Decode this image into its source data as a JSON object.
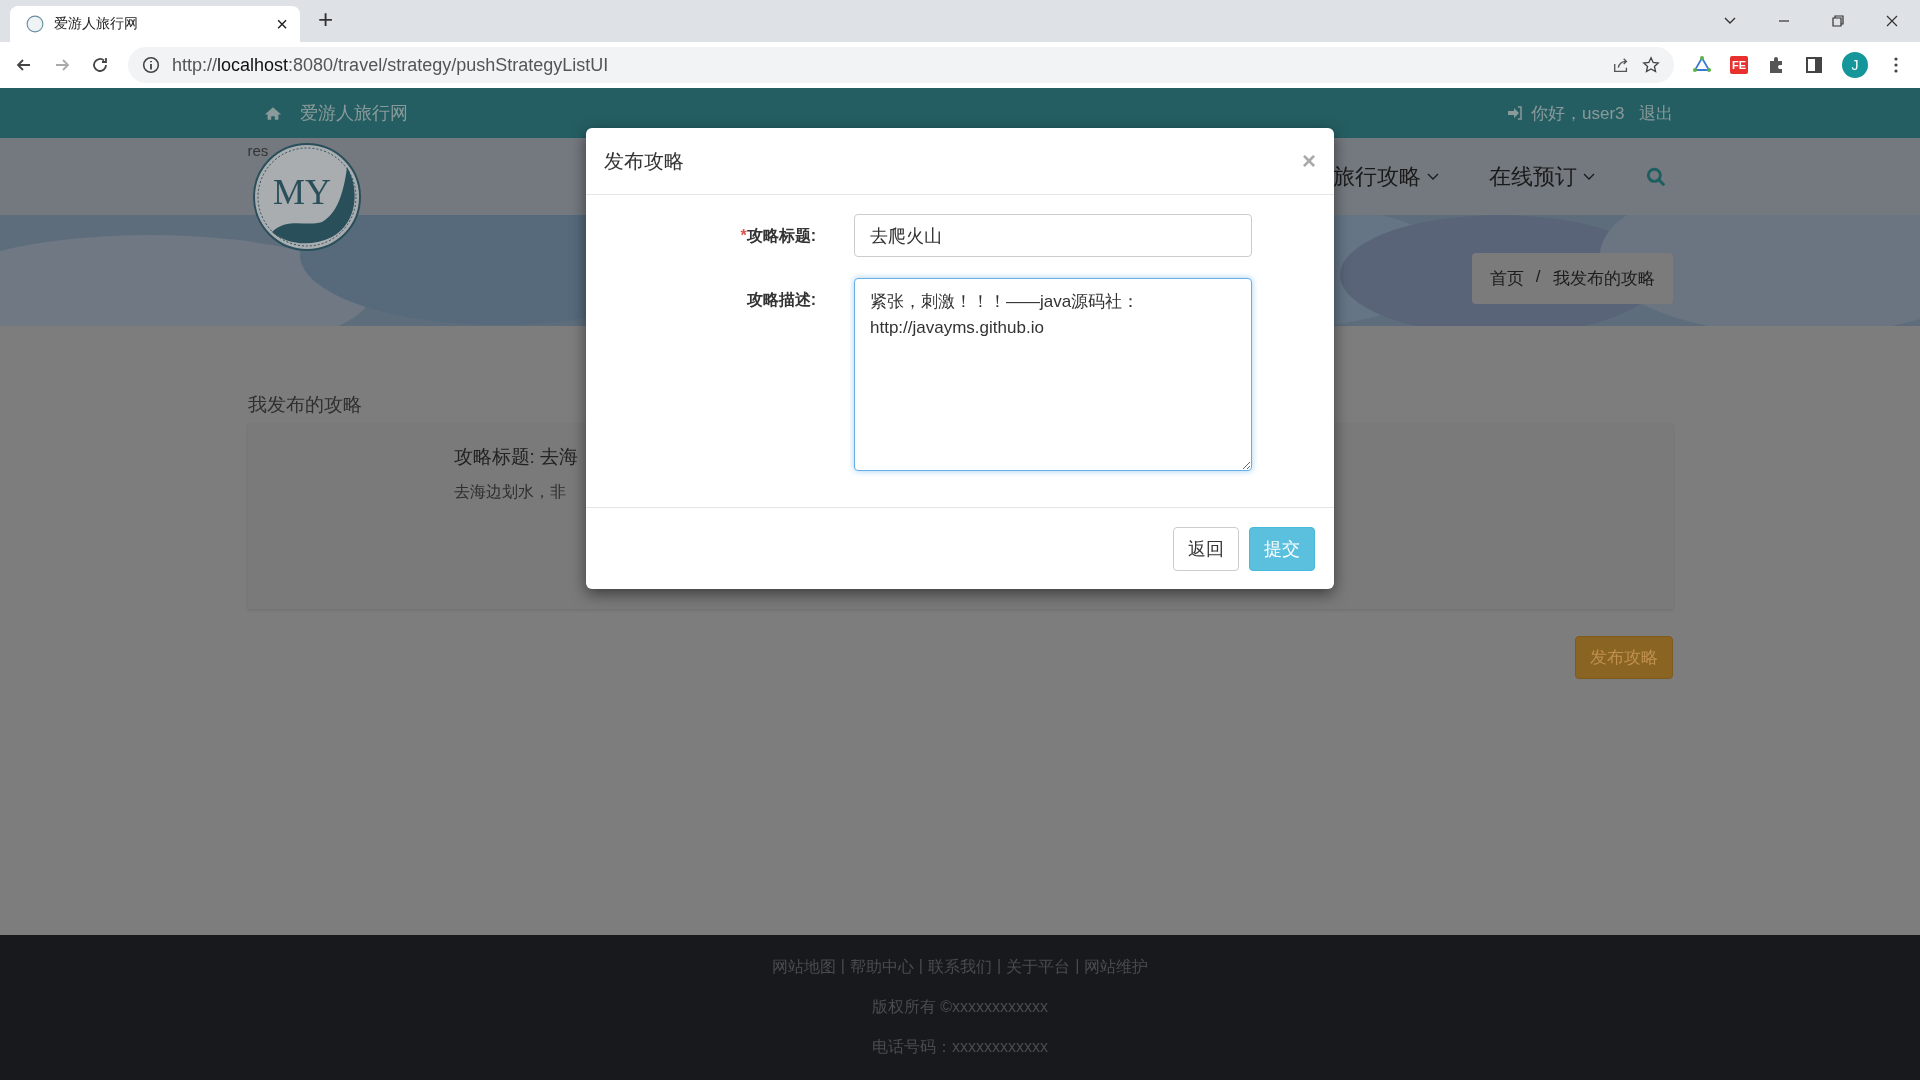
{
  "browser": {
    "tab_title": "爱游人旅行网",
    "tab_close": "×",
    "new_tab": "+",
    "url": "http://**localhost**:8080/travel/strategy/pushStrategyListUI",
    "extension_badge": "FE",
    "profile_initial": "J"
  },
  "top_bar": {
    "site_name": "爱游人旅行网",
    "greeting": "你好，user3",
    "logout": "退出"
  },
  "header": {
    "logo_fallback_text": "res",
    "logo_letters": "MY",
    "nav": [
      {
        "label": "旅行攻略"
      },
      {
        "label": "在线预订"
      }
    ],
    "breadcrumb": [
      {
        "label": "首页"
      },
      {
        "label": "我发布的攻略"
      }
    ],
    "breadcrumb_separator": "/"
  },
  "content": {
    "heading": "我发布的攻略",
    "strategies": [
      {
        "title": "攻略标题: 去海",
        "description": "去海边划水，非"
      }
    ],
    "publish_button": "发布攻略"
  },
  "footer": {
    "links": [
      "网站地图",
      "帮助中心",
      "联系我们",
      "关于平台",
      "网站维护"
    ],
    "link_separator": "|",
    "copyright": "版权所有 ©xxxxxxxxxxxx",
    "phone": "电话号码：xxxxxxxxxxxx"
  },
  "modal": {
    "title": "发布攻略",
    "close": "×",
    "required_mark": "*",
    "fields": [
      {
        "kind": "input",
        "label": "攻略标题:",
        "required": true,
        "value": "去爬火山"
      },
      {
        "kind": "textarea",
        "label": "攻略描述:",
        "required": false,
        "value": "紧张，刺激！！！——java源码社：http://javayms.github.io"
      }
    ],
    "buttons": [
      {
        "kind": "default",
        "label": "返回"
      },
      {
        "kind": "primary",
        "label": "提交"
      }
    ]
  }
}
